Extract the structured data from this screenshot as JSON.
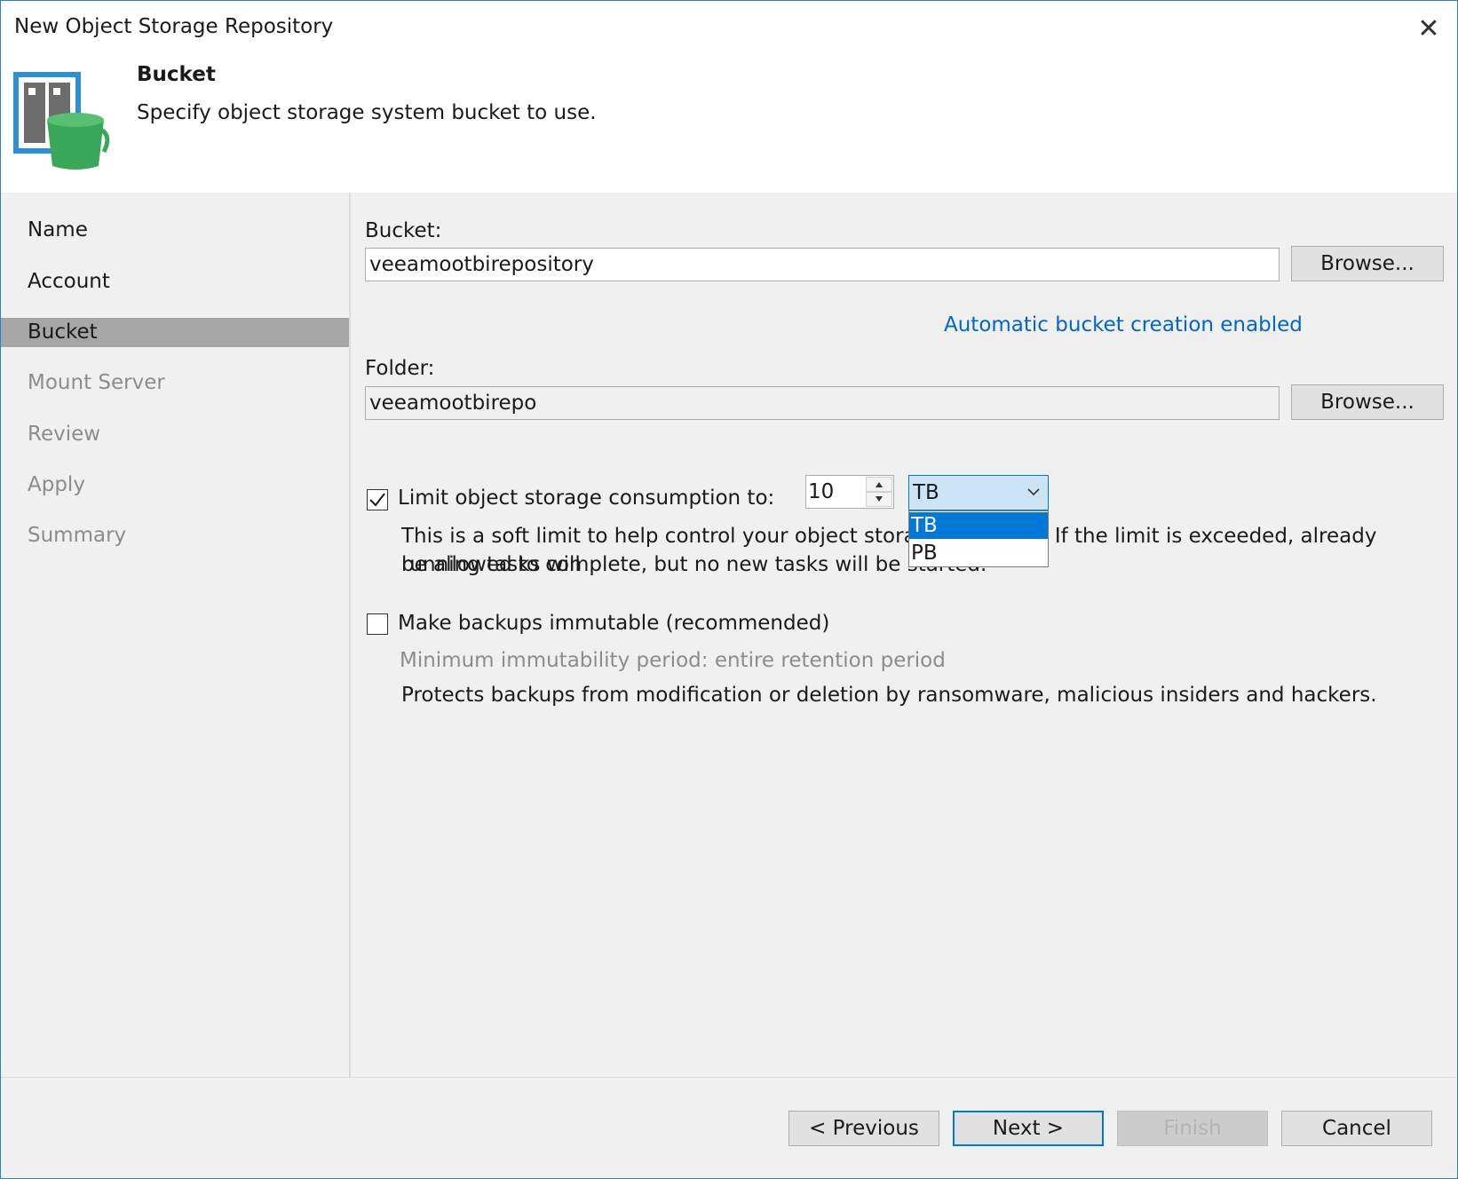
{
  "window": {
    "title": "New Object Storage Repository",
    "close_icon": "close-icon"
  },
  "header": {
    "step_title": "Bucket",
    "step_description": "Specify object storage system bucket to use.",
    "logo_icon": "object-storage-bucket-icon"
  },
  "sidebar": {
    "items": [
      {
        "label": "Name",
        "state": "done"
      },
      {
        "label": "Account",
        "state": "done"
      },
      {
        "label": "Bucket",
        "state": "active"
      },
      {
        "label": "Mount Server",
        "state": "pending"
      },
      {
        "label": "Review",
        "state": "pending"
      },
      {
        "label": "Apply",
        "state": "pending"
      },
      {
        "label": "Summary",
        "state": "pending"
      }
    ]
  },
  "form": {
    "bucket_label": "Bucket:",
    "bucket_value": "veeamootbirepository",
    "browse_label": "Browse...",
    "auto_bucket_link": "Automatic bucket creation enabled",
    "folder_label": "Folder:",
    "folder_value": "veeamootbirepo",
    "limit_checkbox_label": "Limit object storage consumption to:",
    "limit_checked": true,
    "limit_value": "10",
    "unit_selected": "TB",
    "unit_options": [
      "TB",
      "PB"
    ],
    "limit_desc_line1": "This is a soft limit to help control your object storage spending. If the limit is exceeded, already running tasks will",
    "limit_desc_line2": "be allowed to complete, but no new tasks will be started.",
    "immutable_checkbox_label": "Make backups immutable (recommended)",
    "immutable_checked": false,
    "immutability_period": "Minimum immutability period: entire retention period",
    "immutable_desc": "Protects backups from modification or deletion by ransomware, malicious insiders and hackers."
  },
  "footer": {
    "previous_label": "< Previous",
    "next_label": "Next >",
    "finish_label": "Finish",
    "cancel_label": "Cancel"
  },
  "colors": {
    "accent": "#0078d7",
    "link": "#0066cc",
    "selected_nav": "#a6a6a6",
    "bucket_green": "#3aa65a"
  }
}
